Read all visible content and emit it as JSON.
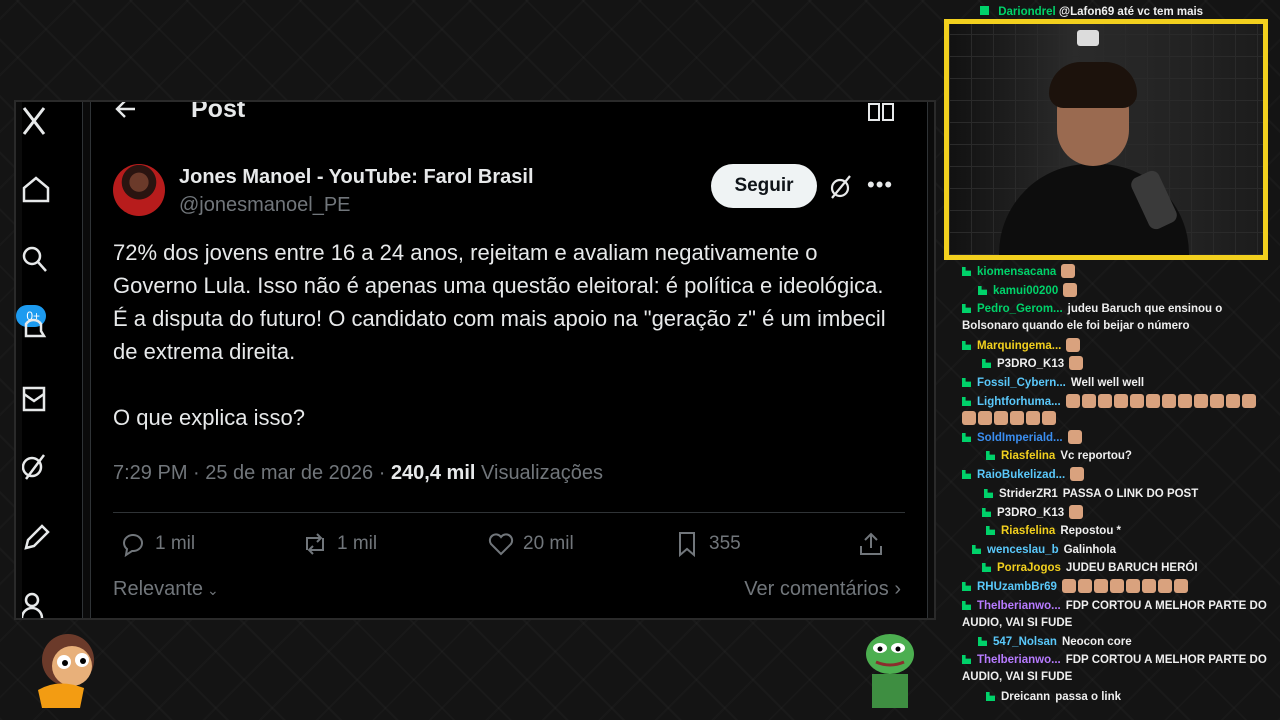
{
  "post": {
    "header_title": "Post",
    "author_name": "Jones Manoel - YouTube: Farol Brasil",
    "author_handle": "@jonesmanoel_PE",
    "follow_label": "Seguir",
    "more_label": "•••",
    "text": "72% dos jovens entre 16 a 24 anos, rejeitam e avaliam negativamente o Governo Lula. Isso não é apenas uma questão eleitoral: é política e ideológica. É a disputa do futuro! O candidato com mais apoio na \"geração z\" é um imbecil de extrema direita.\n\nO que explica isso?",
    "time": "7:29 PM · 25 de mar de 2026 · ",
    "views_count": "240,4 mil",
    "views_label": "Visualizações",
    "replies": "1 mil",
    "reposts": "1 mil",
    "likes": "20 mil",
    "bookmarks": "355",
    "sort_label": "Relevante",
    "comments_link": "Ver comentários"
  },
  "sidebar": {
    "notification_badge": "0+"
  },
  "chat": {
    "top_message": {
      "user": "Dariondrel",
      "text": "@Lafon69 até vc tem mais",
      "color": "#00d26a"
    },
    "messages": [
      {
        "user": "kiomensacana",
        "text": "",
        "color": "#00d26a",
        "emotes": 1
      },
      {
        "user": "kamui00200",
        "text": "",
        "color": "#00d26a",
        "emotes": 1
      },
      {
        "user": "Pedro_Gerom...",
        "text": "judeu Baruch que ensinou o Bolsonaro quando ele foi beijar o número",
        "color": "#00d26a",
        "emotes": 0
      },
      {
        "user": "Marquingema...",
        "text": "",
        "color": "#f2d01e",
        "emotes": 1
      },
      {
        "user": "P3DRO_K13",
        "text": "",
        "color": "#efefef",
        "emotes": 1
      },
      {
        "user": "Fossil_Cybern...",
        "text": "Well well well",
        "color": "#5ac8fa",
        "emotes": 0
      },
      {
        "user": "Lightforhuma...",
        "text": "",
        "color": "#5ac8fa",
        "emotes": 18
      },
      {
        "user": "SoldImperiald...",
        "text": "",
        "color": "#3b8ef0",
        "emotes": 1
      },
      {
        "user": "Riasfelina",
        "text": "Vc reportou?",
        "color": "#f2d01e",
        "emotes": 0
      },
      {
        "user": "RaioBukelizad...",
        "text": "",
        "color": "#5ac8fa",
        "emotes": 1
      },
      {
        "user": "StriderZR1",
        "text": "PASSA O LINK DO POST",
        "color": "#efefef",
        "emotes": 0
      },
      {
        "user": "P3DRO_K13",
        "text": "",
        "color": "#efefef",
        "emotes": 1
      },
      {
        "user": "Riasfelina",
        "text": "Repostou *",
        "color": "#f2d01e",
        "emotes": 0
      },
      {
        "user": "wenceslau_b",
        "text": "Galinhola",
        "color": "#5ac8fa",
        "emotes": 0
      },
      {
        "user": "PorraJogos",
        "text": "JUDEU BARUCH HERÓI",
        "color": "#f2d01e",
        "emotes": 0
      },
      {
        "user": "RHUzambBr69",
        "text": "",
        "color": "#5ac8fa",
        "emotes": 8
      },
      {
        "user": "TheIberianwo...",
        "text": "FDP CORTOU A MELHOR PARTE DO AUDIO, VAI SI FUDE",
        "color": "#b77bff",
        "emotes": 0
      },
      {
        "user": "547_Nolsan",
        "text": "Neocon core",
        "color": "#5ac8fa",
        "emotes": 0
      },
      {
        "user": "TheIberianwo...",
        "text": "FDP CORTOU A MELHOR PARTE DO AUDIO, VAI SI FUDE",
        "color": "#b77bff",
        "emotes": 0
      },
      {
        "user": "Dreicann",
        "text": "passa o link",
        "color": "#efefef",
        "emotes": 0
      }
    ]
  },
  "colors": {
    "cam_border": "#f2d01e",
    "link_blue": "#1d9bf0",
    "muted": "#71767b"
  },
  "icons": [
    "back-arrow-icon",
    "reader-icon",
    "grok-icon",
    "reply-icon",
    "repost-icon",
    "like-icon",
    "bookmark-icon",
    "share-icon",
    "home-icon",
    "search-icon",
    "notifications-icon",
    "messages-icon",
    "grok-sidebar-icon",
    "compose-icon",
    "profile-icon"
  ]
}
